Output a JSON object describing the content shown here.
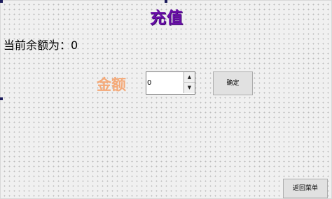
{
  "form": {
    "title": "充值",
    "balance_label": "当前余额为：0",
    "amount_label": "金额",
    "amount_value": "0",
    "confirm_label": "确定",
    "back_label": "返回菜单"
  },
  "icons": {
    "spin_up": "triangle-up-icon",
    "spin_down": "triangle-down-icon"
  },
  "colors": {
    "title": "#6a0ea8",
    "amount_label": "#f4a978",
    "form_background": "#f0f0f0"
  }
}
